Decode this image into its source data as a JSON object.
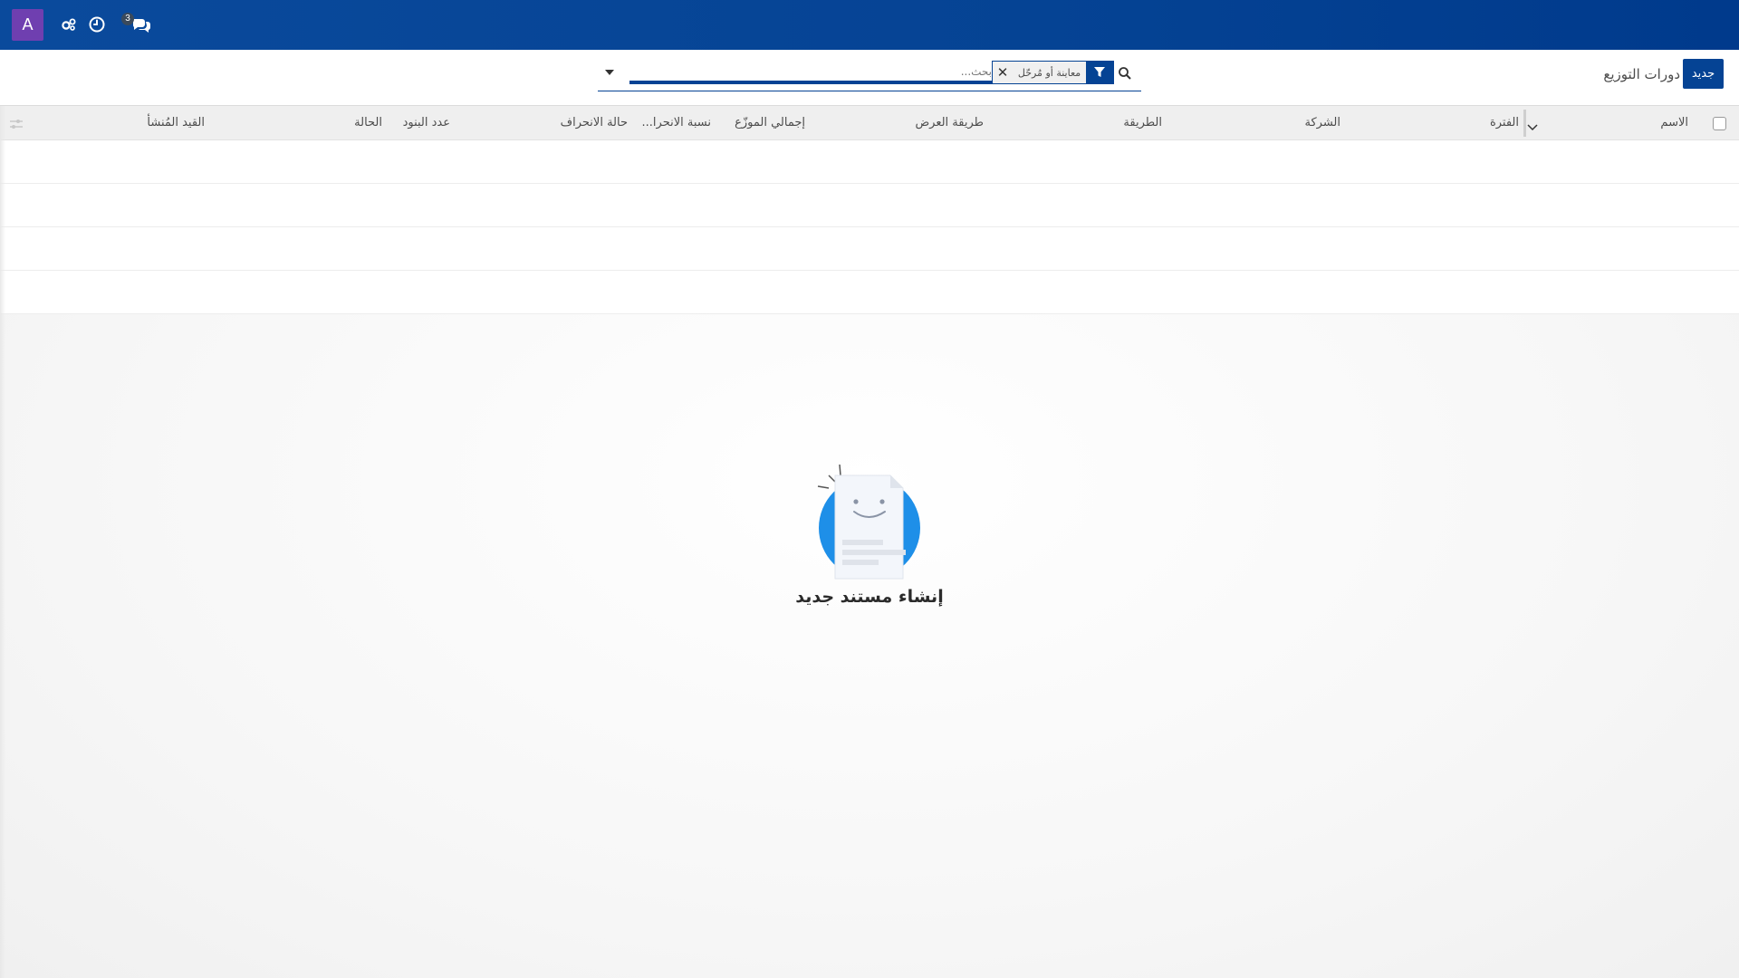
{
  "navbar": {
    "avatar_letter": "A",
    "avatar_color": "#6f3fb0",
    "bg_color": "#054394",
    "icons": [
      "settings-gears-icon",
      "clock-icon",
      "chat-icon"
    ],
    "messages_badge": "3"
  },
  "control_panel": {
    "new_button_label": "جديد",
    "breadcrumb": "دورات التوزيع",
    "search": {
      "placeholder": "بحث...",
      "facet_label": "معاينة أو مُرحّل"
    }
  },
  "table": {
    "columns": [
      "الاسم",
      "الفترة",
      "الشركة",
      "الطريقة",
      "طريقة العرض",
      "إجمالي الموزّع",
      "نسبة الانحرا...",
      "حالة الانحراف",
      "عدد البنود",
      "الحالة",
      "القيد المُنشأ"
    ]
  },
  "empty_state": {
    "title": "إنشاء مستند جديد"
  },
  "colors": {
    "primary": "#054394",
    "header_bg": "#efefef",
    "illustration_blue": "#1e8fe8"
  }
}
